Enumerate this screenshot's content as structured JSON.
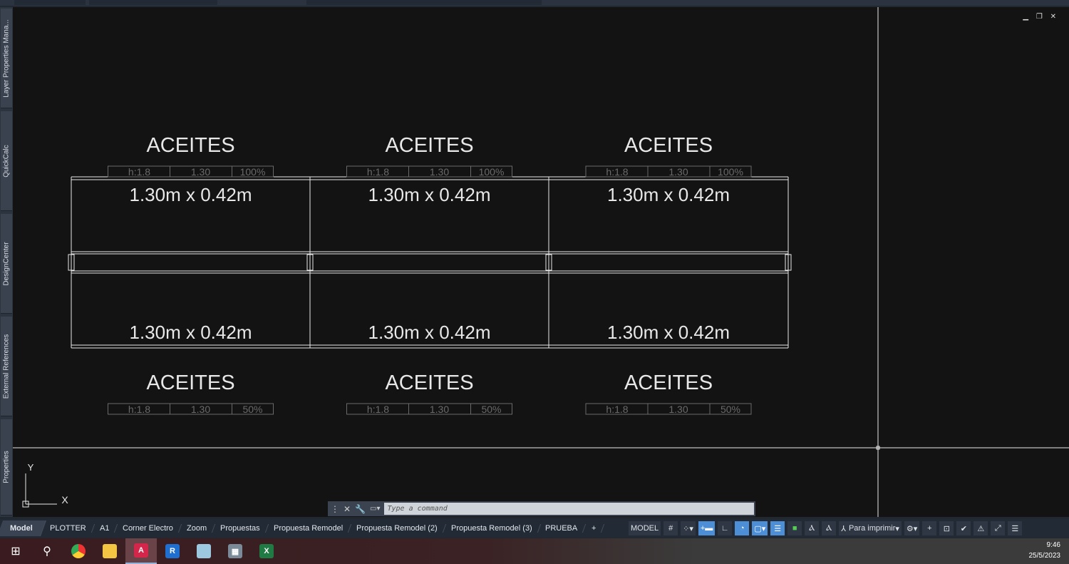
{
  "side_palettes": [
    "Layer Properties Mana...",
    "QuickCalc",
    "DesignCenter",
    "External References",
    "Properties"
  ],
  "viewport_controls": "▁ ❐ ✕",
  "drawing": {
    "top_row": [
      {
        "title": "ACEITES",
        "tag": [
          "h:1.8",
          "1.30",
          "100%"
        ],
        "dimension": "1.30m x 0.42m"
      },
      {
        "title": "ACEITES",
        "tag": [
          "h:1.8",
          "1.30",
          "100%"
        ],
        "dimension": "1.30m x 0.42m"
      },
      {
        "title": "ACEITES",
        "tag": [
          "h:1.8",
          "1.30",
          "100%"
        ],
        "dimension": "1.30m x 0.42m"
      }
    ],
    "bottom_row": [
      {
        "title": "ACEITES",
        "tag": [
          "h:1.8",
          "1.30",
          "50%"
        ],
        "dimension": "1.30m x 0.42m"
      },
      {
        "title": "ACEITES",
        "tag": [
          "h:1.8",
          "1.30",
          "50%"
        ],
        "dimension": "1.30m x 0.42m"
      },
      {
        "title": "ACEITES",
        "tag": [
          "h:1.8",
          "1.30",
          "50%"
        ],
        "dimension": "1.30m x 0.42m"
      }
    ],
    "ucs": {
      "x": "X",
      "y": "Y"
    }
  },
  "command": {
    "placeholder": "Type a command"
  },
  "layout_tabs": [
    "Model",
    "PLOTTER",
    "A1",
    "Corner Electro",
    "Zoom",
    "Propuestas",
    "Propuesta Remodel",
    "Propuesta Remodel (2)",
    "Propuesta Remodel (3)",
    "PRUEBA",
    "+"
  ],
  "status": {
    "model": "MODEL",
    "annotation_scale": "Para imprimir"
  },
  "taskbar": {
    "time": "9:46",
    "date": "25/5/2023"
  },
  "colors": {
    "canvas": "#131313",
    "lines": "#e8e8e8",
    "tag": "#6a6a6a",
    "accent": "#4d8fd6"
  }
}
